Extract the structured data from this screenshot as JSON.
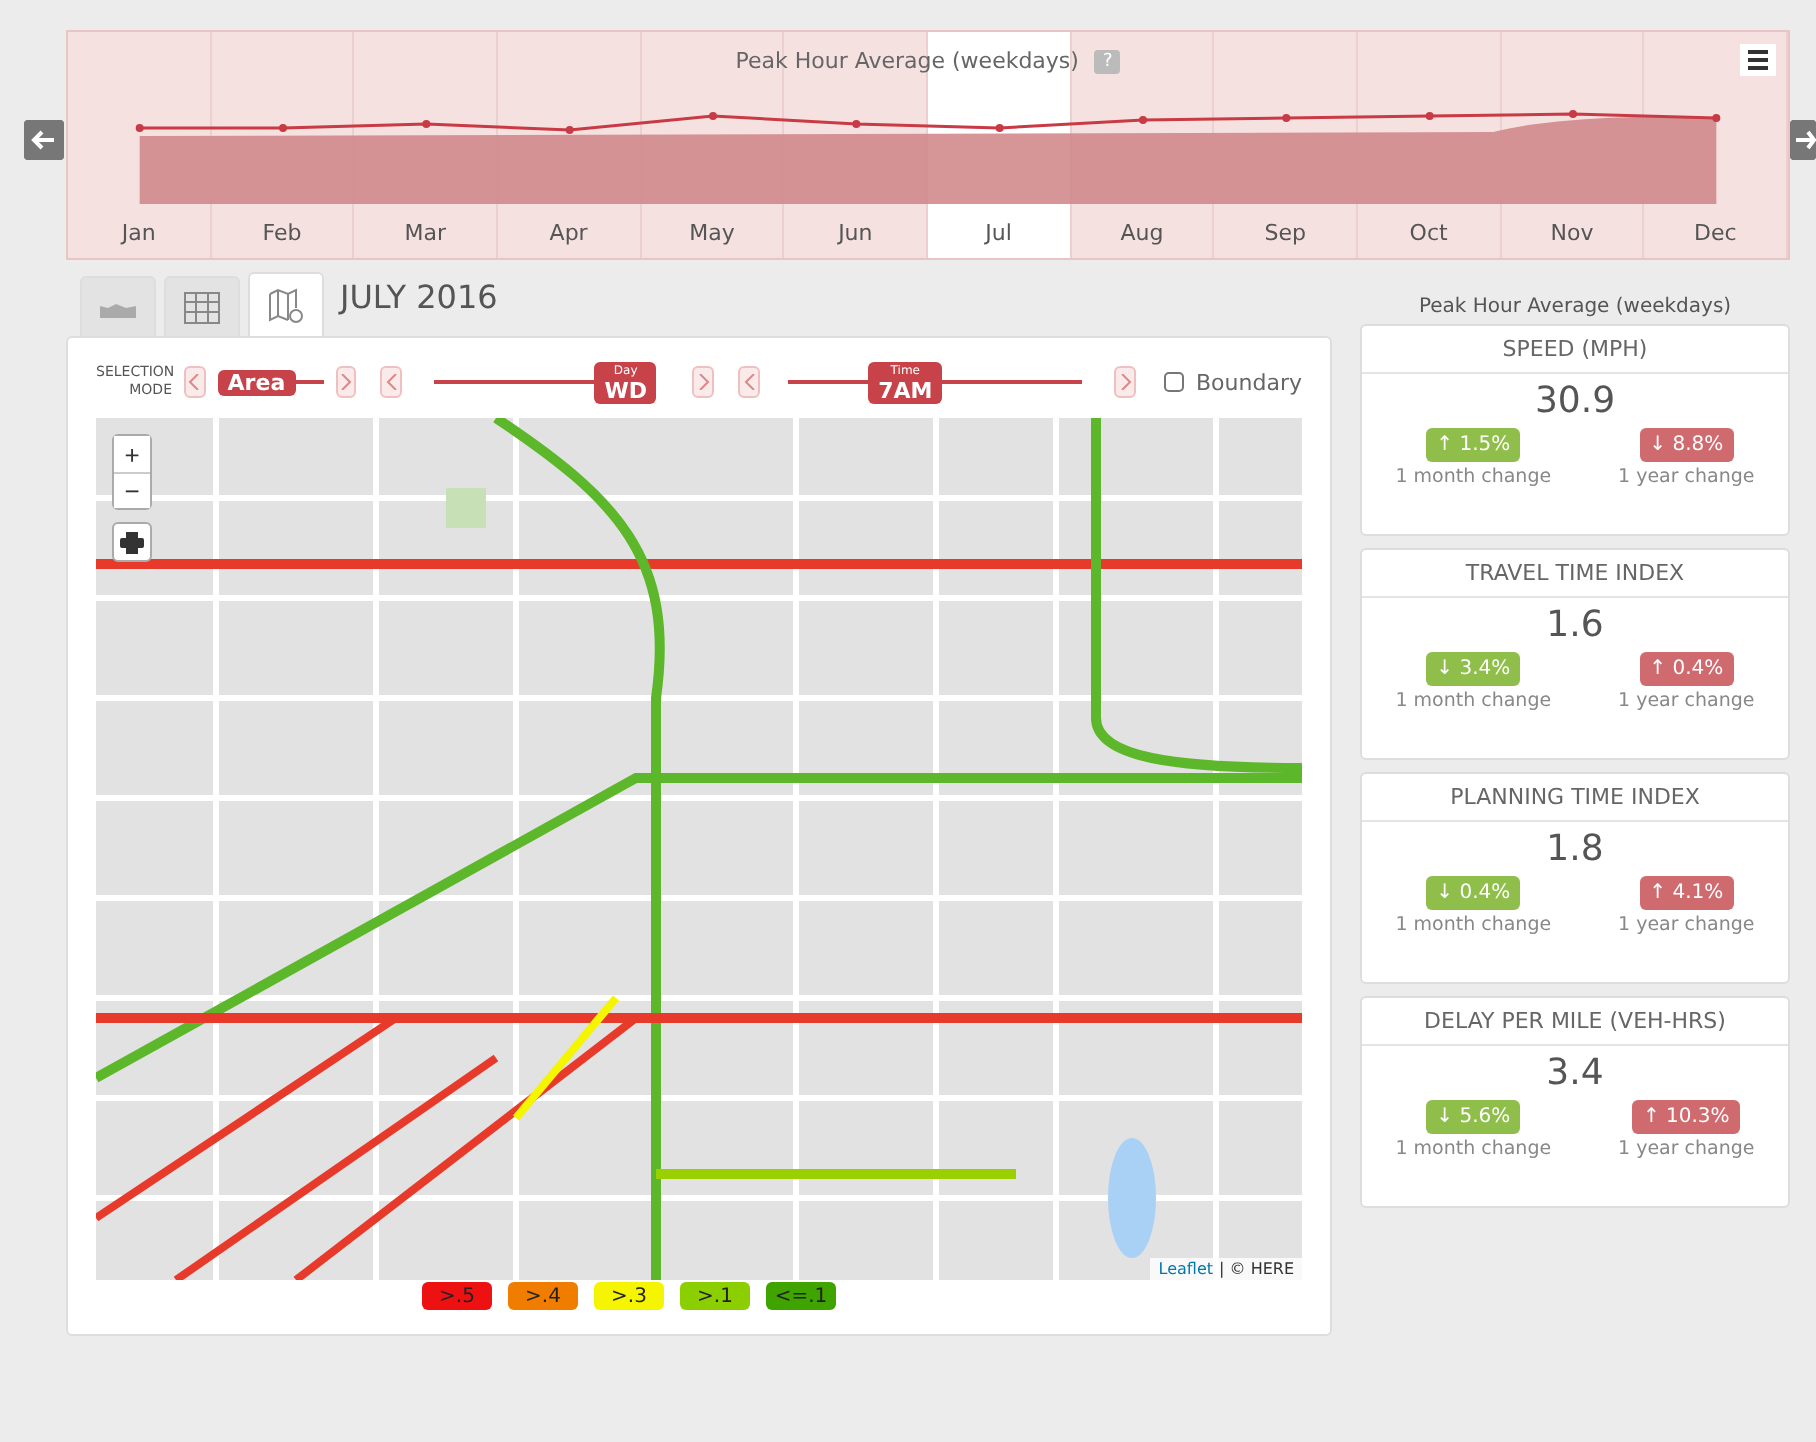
{
  "trend_chart": {
    "title": "Peak Hour Average (weekdays)",
    "help": "?",
    "months": [
      {
        "label": "Jan",
        "selected": false
      },
      {
        "label": "Feb",
        "selected": false
      },
      {
        "label": "Mar",
        "selected": false
      },
      {
        "label": "Apr",
        "selected": false
      },
      {
        "label": "May",
        "selected": false
      },
      {
        "label": "Jun",
        "selected": false
      },
      {
        "label": "Jul",
        "selected": true
      },
      {
        "label": "Aug",
        "selected": false
      },
      {
        "label": "Sep",
        "selected": false
      },
      {
        "label": "Oct",
        "selected": false
      },
      {
        "label": "Nov",
        "selected": false
      },
      {
        "label": "Dec",
        "selected": false
      }
    ]
  },
  "view_tabs": [
    {
      "kind": "chart",
      "selected": false
    },
    {
      "kind": "table",
      "selected": false
    },
    {
      "kind": "map",
      "selected": true
    }
  ],
  "period": "JULY 2016",
  "controls": {
    "selection_mode": "SELECTION MODE",
    "area": "Area",
    "day_label": "Day",
    "day": "WD",
    "time_label": "Time",
    "time": "7AM",
    "boundary": {
      "label": "Boundary",
      "checked": false
    }
  },
  "map": {
    "zoom_in": "+",
    "zoom_out": "−",
    "attribution_link": "Leaflet",
    "attribution": "| © HERE"
  },
  "legend": [
    {
      "label": ">.5",
      "color": "#ee1111"
    },
    {
      "label": ">.4",
      "color": "#f07d00"
    },
    {
      "label": ">.3",
      "color": "#f5f500"
    },
    {
      "label": ">.1",
      "color": "#8ccf00"
    },
    {
      "label": "<=.1",
      "color": "#3fa300"
    }
  ],
  "stats_title": "Peak Hour Average (weekdays)",
  "stats": [
    {
      "title": "SPEED (MPH)",
      "value": "30.9",
      "month": {
        "text": "↑ 1.5%",
        "color": "#8fbf4a"
      },
      "month_label": "1 month change",
      "year": {
        "text": "↓ 8.8%",
        "color": "#cf6b6f"
      },
      "year_label": "1 year change"
    },
    {
      "title": "TRAVEL TIME INDEX",
      "value": "1.6",
      "month": {
        "text": "↓ 3.4%",
        "color": "#8fbf4a"
      },
      "month_label": "1 month change",
      "year": {
        "text": "↑ 0.4%",
        "color": "#cf6b6f"
      },
      "year_label": "1 year change"
    },
    {
      "title": "PLANNING TIME INDEX",
      "value": "1.8",
      "month": {
        "text": "↓ 0.4%",
        "color": "#8fbf4a"
      },
      "month_label": "1 month change",
      "year": {
        "text": "↑ 4.1%",
        "color": "#cf6b6f"
      },
      "year_label": "1 year change"
    },
    {
      "title": "DELAY PER MILE (VEH-HRS)",
      "value": "3.4",
      "month": {
        "text": "↓ 5.6%",
        "color": "#8fbf4a"
      },
      "month_label": "1 month change",
      "year": {
        "text": "↑ 10.3%",
        "color": "#cf6b6f"
      },
      "year_label": "1 year change"
    }
  ]
}
